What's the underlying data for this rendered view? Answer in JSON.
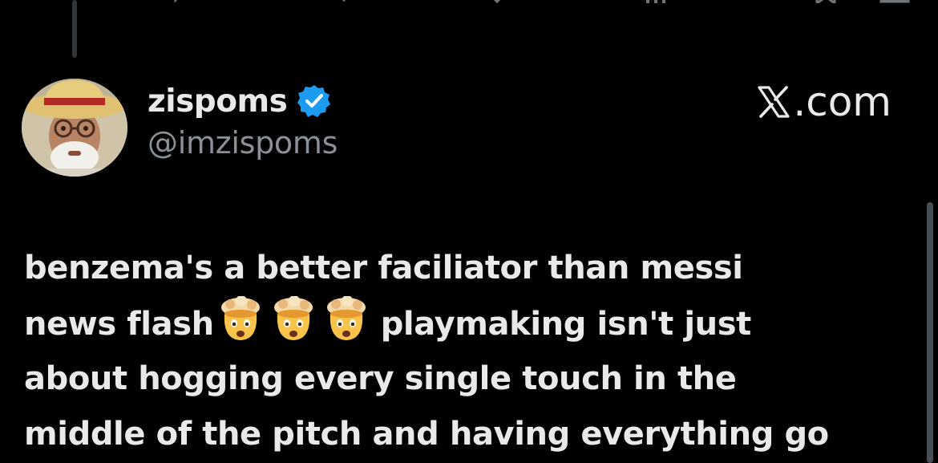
{
  "app": {
    "background": "#000000",
    "accent": "#1d9bf0"
  },
  "post": {
    "author": {
      "display_name": "zispoms",
      "handle": "@imzispoms",
      "verified": true,
      "avatar_icon": "avatar-straw-hat-icon"
    },
    "brand_label": ".com",
    "brand_icon": "x-logo-icon",
    "text_lines": [
      "benzema's a better faciliator than messi",
      "news flash",
      "playmaking isn't just",
      "about hogging every single touch in the",
      "middle of the pitch and having everything go"
    ],
    "emojis": [
      "exploding-head-emoji",
      "exploding-head-emoji",
      "exploding-head-emoji"
    ]
  },
  "icons": {
    "top_actions": [
      "reply-icon",
      "repost-icon",
      "like-icon",
      "views-icon",
      "bookmark-icon",
      "share-icon"
    ]
  }
}
